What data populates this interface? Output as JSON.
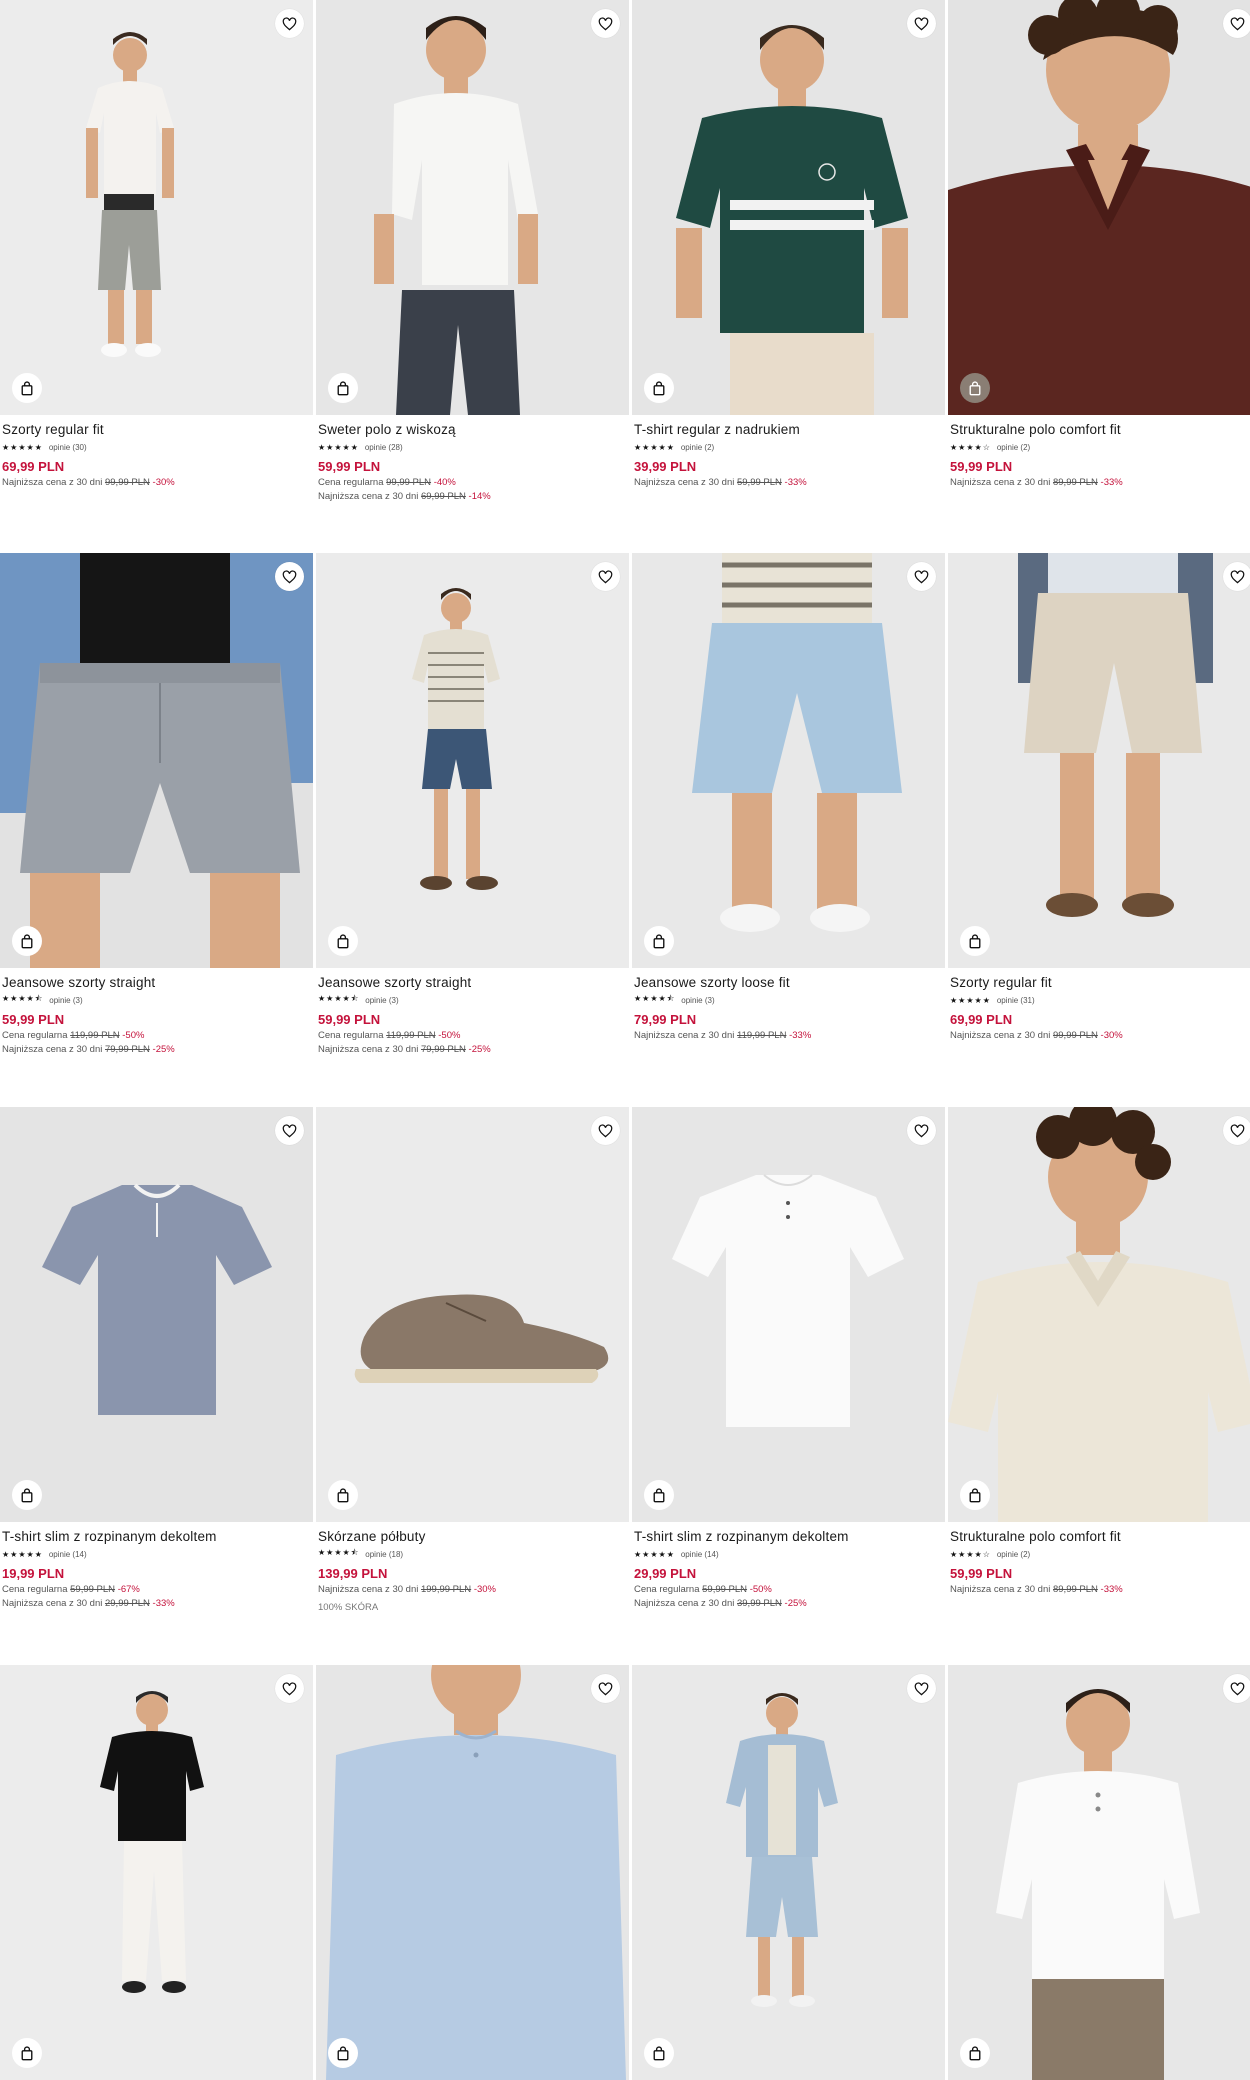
{
  "products": [
    {
      "name": "Szorty regular fit",
      "stars": "★★★★★",
      "reviews": "opinie (30)",
      "price": "69,99 PLN",
      "lines": [
        {
          "label": "Najniższa cena z 30 dni",
          "old": "99,99 PLN",
          "pct": "-30%"
        }
      ],
      "extra": "",
      "bg": "#ececec",
      "art": "man-shorts-white-polo",
      "bag_dark": false
    },
    {
      "name": "Sweter polo z wiskozą",
      "stars": "★★★★★",
      "reviews": "opinie (28)",
      "price": "59,99 PLN",
      "lines": [
        {
          "label": "Cena regularna",
          "old": "99,99 PLN",
          "pct": "-40%"
        },
        {
          "label": "Najniższa cena z 30 dni",
          "old": "69,99 PLN",
          "pct": "-14%"
        }
      ],
      "extra": "",
      "bg": "#e6e6e6",
      "art": "man-white-polo-navy-pants",
      "bag_dark": false
    },
    {
      "name": "T-shirt regular z nadrukiem",
      "stars": "★★★★★",
      "reviews": "opinie (2)",
      "price": "39,99 PLN",
      "lines": [
        {
          "label": "Najniższa cena z 30 dni",
          "old": "59,99 PLN",
          "pct": "-33%"
        }
      ],
      "extra": "",
      "bg": "#e5e5e5",
      "art": "man-green-striped-tee",
      "bag_dark": false
    },
    {
      "name": "Strukturalne polo comfort fit",
      "stars": "★★★★☆",
      "reviews": "opinie (2)",
      "price": "59,99 PLN",
      "lines": [
        {
          "label": "Najniższa cena z 30 dni",
          "old": "89,99 PLN",
          "pct": "-33%"
        }
      ],
      "extra": "",
      "bg": "#e3e3e3",
      "art": "man-burgundy-polo",
      "bag_dark": true
    },
    {
      "name": "Jeansowe szorty straight",
      "stars": "★★★★⯪",
      "reviews": "opinie (3)",
      "price": "59,99 PLN",
      "lines": [
        {
          "label": "Cena regularna",
          "old": "119,99 PLN",
          "pct": "-50%"
        },
        {
          "label": "Najniższa cena z 30 dni",
          "old": "79,99 PLN",
          "pct": "-25%"
        }
      ],
      "extra": "",
      "bg": "#e2e2e2",
      "art": "grey-denim-shorts-closeup",
      "bag_dark": false
    },
    {
      "name": "Jeansowe szorty straight",
      "stars": "★★★★⯪",
      "reviews": "opinie (3)",
      "price": "59,99 PLN",
      "lines": [
        {
          "label": "Cena regularna",
          "old": "119,99 PLN",
          "pct": "-50%"
        },
        {
          "label": "Najniższa cena z 30 dni",
          "old": "79,99 PLN",
          "pct": "-25%"
        }
      ],
      "extra": "",
      "bg": "#ebebeb",
      "art": "man-striped-polo-denim-shorts",
      "bag_dark": false
    },
    {
      "name": "Jeansowe szorty loose fit",
      "stars": "★★★★⯪",
      "reviews": "opinie (3)",
      "price": "79,99 PLN",
      "lines": [
        {
          "label": "Najniższa cena z 30 dni",
          "old": "119,99 PLN",
          "pct": "-33%"
        }
      ],
      "extra": "",
      "bg": "#e8e8e8",
      "art": "light-denim-shorts-legs",
      "bag_dark": false
    },
    {
      "name": "Szorty regular fit",
      "stars": "★★★★★",
      "reviews": "opinie (31)",
      "price": "69,99 PLN",
      "lines": [
        {
          "label": "Najniższa cena z 30 dni",
          "old": "99,99 PLN",
          "pct": "-30%"
        }
      ],
      "extra": "",
      "bg": "#e9e9e9",
      "art": "beige-shorts-legs",
      "bag_dark": false
    },
    {
      "name": "T-shirt slim z rozpinanym dekoltem",
      "stars": "★★★★★",
      "reviews": "opinie (14)",
      "price": "19,99 PLN",
      "lines": [
        {
          "label": "Cena regularna",
          "old": "59,99 PLN",
          "pct": "-67%"
        },
        {
          "label": "Najniższa cena z 30 dni",
          "old": "29,99 PLN",
          "pct": "-33%"
        }
      ],
      "extra": "",
      "bg": "#e4e4e4",
      "art": "blue-henley-flatlay",
      "bag_dark": false
    },
    {
      "name": "Skórzane półbuty",
      "stars": "★★★★⯪",
      "reviews": "opinie (18)",
      "price": "139,99 PLN",
      "lines": [
        {
          "label": "Najniższa cena z 30 dni",
          "old": "199,99 PLN",
          "pct": "-30%"
        }
      ],
      "extra": "100% SKÓRA",
      "bg": "#ebebeb",
      "art": "suede-shoe",
      "bag_dark": false
    },
    {
      "name": "T-shirt slim z rozpinanym dekoltem",
      "stars": "★★★★★",
      "reviews": "opinie (14)",
      "price": "29,99 PLN",
      "lines": [
        {
          "label": "Cena regularna",
          "old": "59,99 PLN",
          "pct": "-50%"
        },
        {
          "label": "Najniższa cena z 30 dni",
          "old": "39,99 PLN",
          "pct": "-25%"
        }
      ],
      "extra": "",
      "bg": "#e6e6e6",
      "art": "white-henley-flatlay",
      "bag_dark": false
    },
    {
      "name": "Strukturalne polo comfort fit",
      "stars": "★★★★☆",
      "reviews": "opinie (2)",
      "price": "59,99 PLN",
      "lines": [
        {
          "label": "Najniższa cena z 30 dni",
          "old": "89,99 PLN",
          "pct": "-33%"
        }
      ],
      "extra": "",
      "bg": "#e8e8e8",
      "art": "man-cream-polo",
      "bag_dark": false
    },
    {
      "name": "",
      "stars": "",
      "reviews": "",
      "price": "",
      "lines": [],
      "extra": "",
      "bg": "#ececec",
      "art": "man-black-henley-white-pants",
      "bag_dark": false
    },
    {
      "name": "",
      "stars": "",
      "reviews": "",
      "price": "",
      "lines": [],
      "extra": "",
      "bg": "#e6e6e6",
      "art": "man-light-blue-henley",
      "bag_dark": false
    },
    {
      "name": "",
      "stars": "",
      "reviews": "",
      "price": "",
      "lines": [],
      "extra": "",
      "bg": "#e9e9e9",
      "art": "man-denim-set",
      "bag_dark": false
    },
    {
      "name": "",
      "stars": "",
      "reviews": "",
      "price": "",
      "lines": [],
      "extra": "",
      "bg": "#e7e7e7",
      "art": "man-white-henley",
      "bag_dark": false
    }
  ],
  "icons": {
    "favorite": "heart-icon",
    "cart": "shopping-bag-icon"
  },
  "colors": {
    "price": "#c4123b",
    "discount": "#c4123b",
    "text": "#1a1a1a"
  }
}
